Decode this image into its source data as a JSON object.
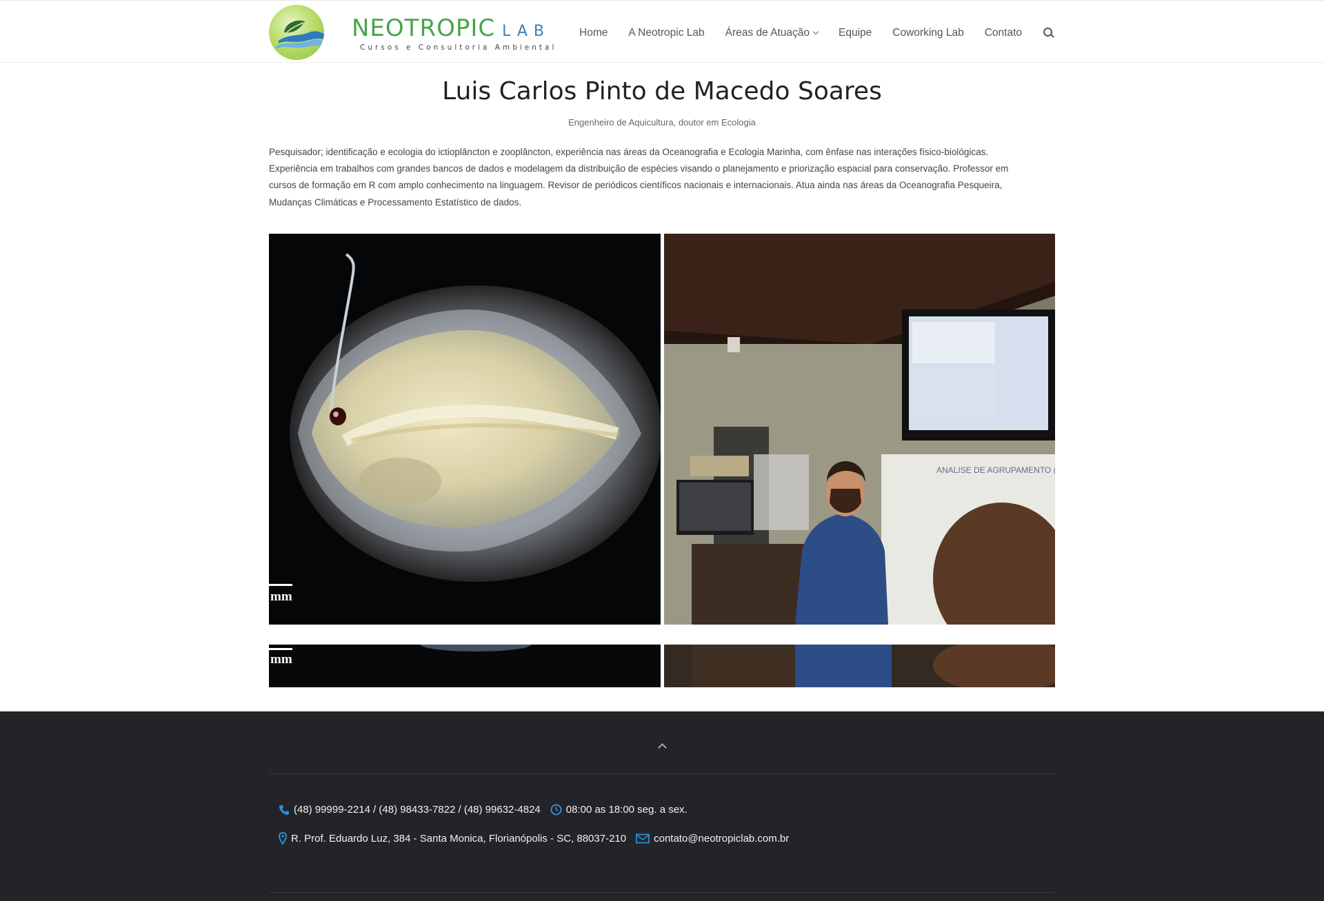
{
  "header": {
    "logo": {
      "title": "NEOTROPIC",
      "suffix": "LAB",
      "tagline": "Cursos e Consultoria Ambiental"
    },
    "nav": [
      {
        "label": "Home"
      },
      {
        "label": "A Neotropic Lab"
      },
      {
        "label": "Áreas de Atuação",
        "has_dropdown": true
      },
      {
        "label": "Equipe"
      },
      {
        "label": "Coworking Lab"
      },
      {
        "label": "Contato"
      }
    ],
    "search_icon": "search-icon"
  },
  "profile": {
    "name": "Luis Carlos Pinto de Macedo Soares",
    "subtitle": "Engenheiro de Aquicultura, doutor em Ecologia",
    "bio_lines": [
      "Pesquisador; identificação e ecologia do ictioplâncton e zooplâncton, experiência nas áreas da Oceanografia e Ecologia Marinha, com ênfase nas interações físico-biológicas.",
      "Experiência em trabalhos com grandes bancos de dados e modelagem da distribuição de espécies visando o planejamento e priorização espacial para conservação. Professor em",
      "cursos de formação em R com amplo conhecimento na linguagem. Revisor de periódicos científicos nacionais e internacionais.  Atua ainda nas áreas da Oceanografia Pesqueira,",
      "Mudanças Climáticas e Processamento Estatístico de dados."
    ]
  },
  "gallery": {
    "scale_label": "mm",
    "whiteboard_text": "ANALISE DE AGRUPAMENTO (CLUST"
  },
  "footer": {
    "phones": "(48) 99999-2214 / (48) 98433-7822 / (48) 99632-4824",
    "hours": "08:00 as 18:00 seg. a sex.",
    "address": "R. Prof. Eduardo Luz, 384 - Santa Monica, Florianópolis - SC, 88037-210",
    "email": "contato@neotropiclab.com.br"
  },
  "colors": {
    "logo_green": "#4ca24a",
    "logo_blue": "#3b7fb7",
    "footer_bg": "#232428",
    "icon_blue": "#2b8fd6"
  }
}
